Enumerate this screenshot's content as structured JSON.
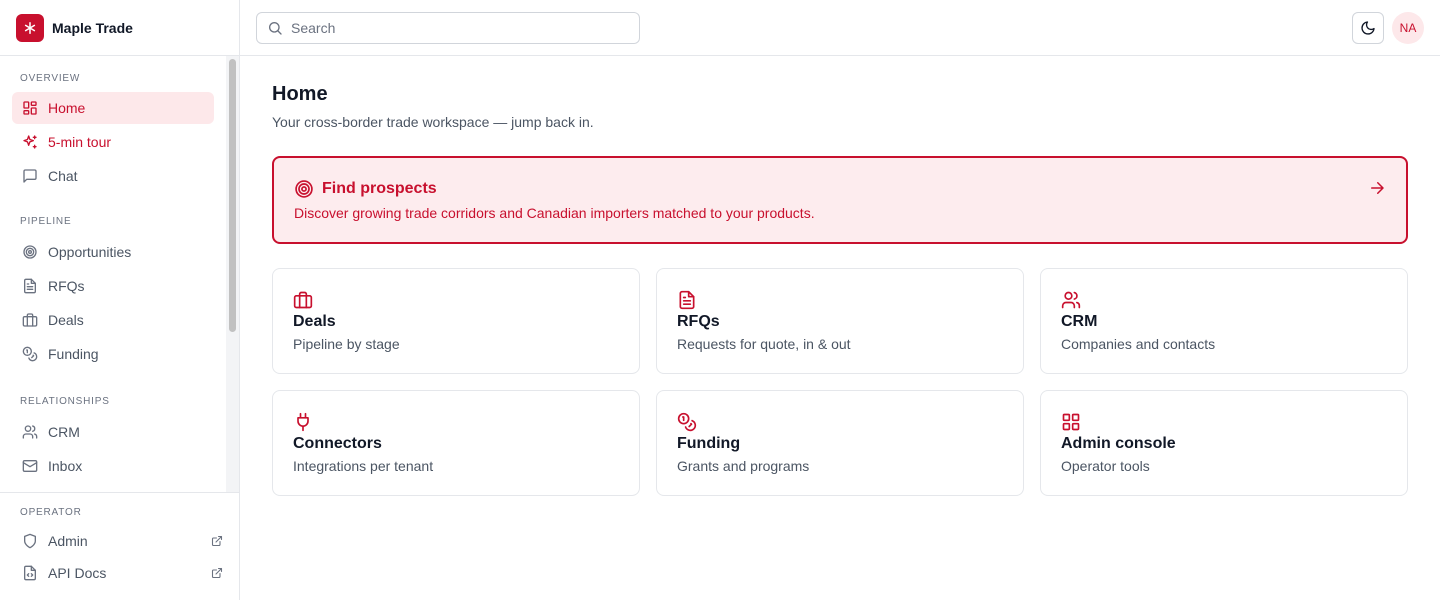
{
  "brand": {
    "name": "Maple Trade"
  },
  "search": {
    "placeholder": "Search"
  },
  "user": {
    "initials": "NA"
  },
  "colors": {
    "accent": "#c8102e",
    "accent_bg": "#fde8ea",
    "border": "#e5e7eb"
  },
  "sidebar": {
    "sections": [
      {
        "label": "OVERVIEW",
        "items": [
          {
            "label": "Home",
            "icon": "layout-dashboard-icon",
            "active": true
          },
          {
            "label": "5-min tour",
            "icon": "sparkles-icon"
          },
          {
            "label": "Chat",
            "icon": "message-square-icon"
          }
        ]
      },
      {
        "label": "PIPELINE",
        "items": [
          {
            "label": "Opportunities",
            "icon": "target-icon"
          },
          {
            "label": "RFQs",
            "icon": "file-text-icon"
          },
          {
            "label": "Deals",
            "icon": "briefcase-icon"
          },
          {
            "label": "Funding",
            "icon": "coins-icon"
          }
        ]
      },
      {
        "label": "RELATIONSHIPS",
        "items": [
          {
            "label": "CRM",
            "icon": "users-icon"
          },
          {
            "label": "Inbox",
            "icon": "mail-icon"
          }
        ]
      }
    ],
    "operator": {
      "label": "OPERATOR",
      "items": [
        {
          "label": "Admin",
          "icon": "shield-icon",
          "external": true
        },
        {
          "label": "API Docs",
          "icon": "file-code-icon",
          "external": true
        }
      ]
    }
  },
  "main": {
    "title": "Home",
    "subtitle": "Your cross-border trade workspace — jump back in.",
    "banner": {
      "title": "Find prospects",
      "description": "Discover growing trade corridors and Canadian importers matched to your products.",
      "icon": "target-icon"
    },
    "cards": [
      {
        "title": "Deals",
        "description": "Pipeline by stage",
        "icon": "briefcase-icon"
      },
      {
        "title": "RFQs",
        "description": "Requests for quote, in & out",
        "icon": "file-text-icon"
      },
      {
        "title": "CRM",
        "description": "Companies and contacts",
        "icon": "users-icon"
      },
      {
        "title": "Connectors",
        "description": "Integrations per tenant",
        "icon": "plug-icon"
      },
      {
        "title": "Funding",
        "description": "Grants and programs",
        "icon": "coins-icon"
      },
      {
        "title": "Admin console",
        "description": "Operator tools",
        "icon": "grid-icon"
      }
    ]
  }
}
